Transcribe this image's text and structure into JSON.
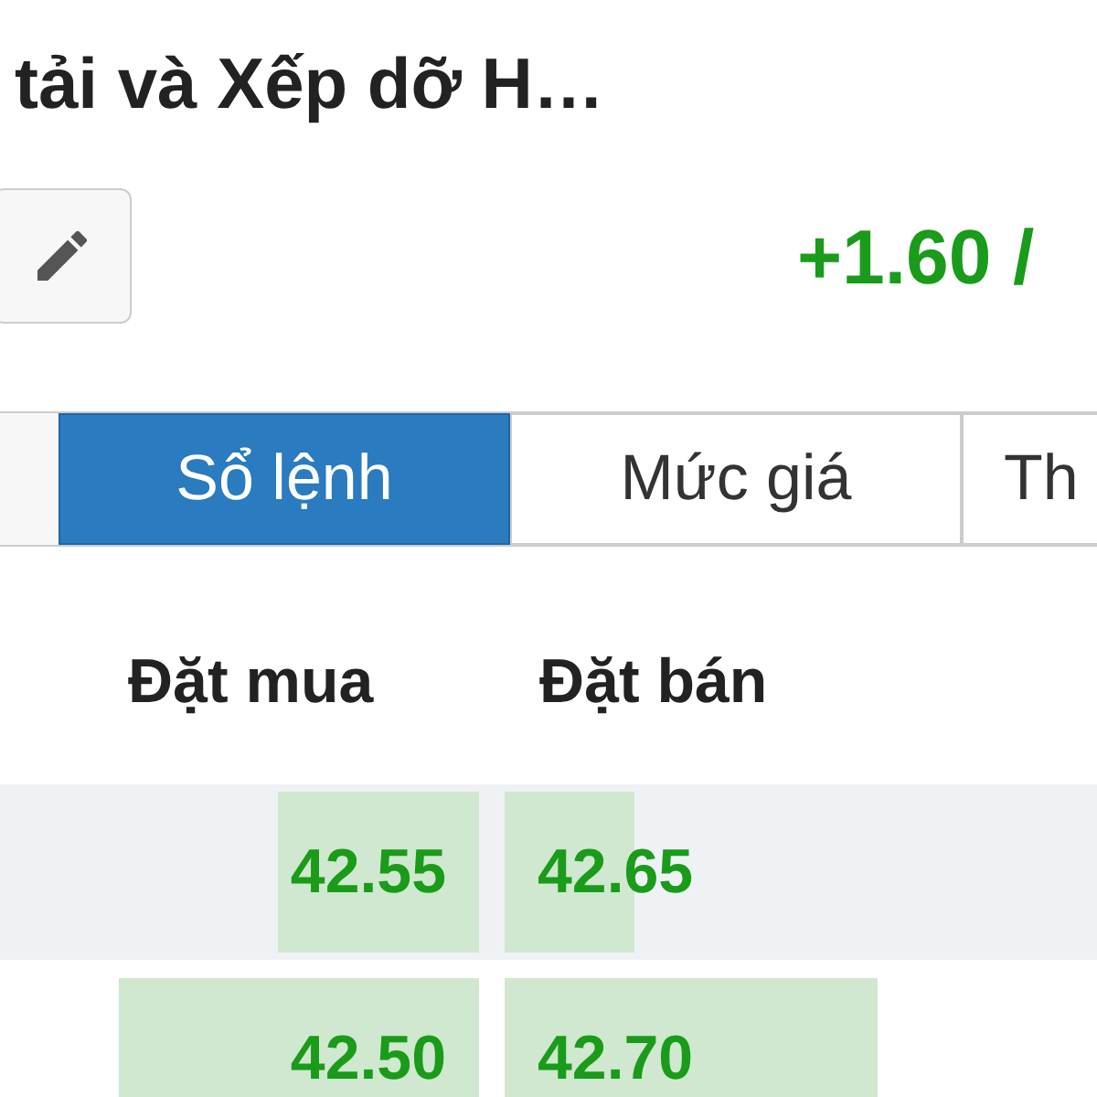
{
  "title": "tải và Xếp dỡ H…",
  "change": "+1.60 /",
  "tabs": [
    {
      "label": "Sổ lệnh",
      "selected": true
    },
    {
      "label": "Mức giá",
      "selected": false
    },
    {
      "label": "Th",
      "selected": false
    }
  ],
  "columns": [
    "Đặt mua",
    "Đặt bán"
  ],
  "rows": [
    {
      "bid": "42.55",
      "ask": "42.65"
    },
    {
      "bid": "42.50",
      "ask": "42.70"
    }
  ]
}
